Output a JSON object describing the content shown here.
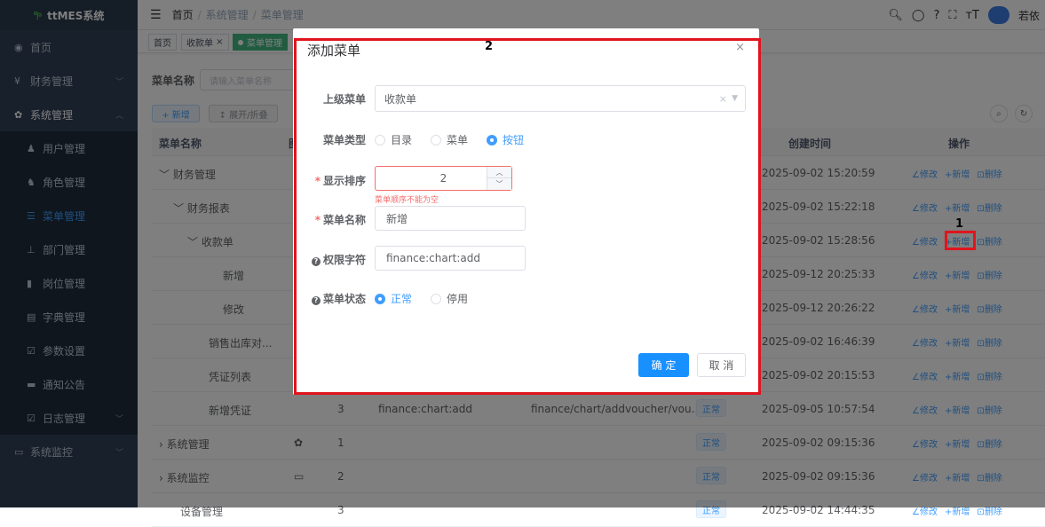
{
  "app": {
    "name": "ttMES系统"
  },
  "sidebar": {
    "items": [
      {
        "icon": "dashboard-icon",
        "label": "首页"
      },
      {
        "icon": "yen-icon",
        "label": "财务管理",
        "arrow": "﹀"
      },
      {
        "icon": "gear-icon",
        "label": "系统管理",
        "arrow": "︿"
      },
      {
        "icon": "user-icon",
        "label": "用户管理"
      },
      {
        "icon": "users-icon",
        "label": "角色管理"
      },
      {
        "icon": "menu-list-icon",
        "label": "菜单管理"
      },
      {
        "icon": "org-tree-icon",
        "label": "部门管理"
      },
      {
        "icon": "post-icon",
        "label": "岗位管理"
      },
      {
        "icon": "dict-icon",
        "label": "字典管理"
      },
      {
        "icon": "edit-icon",
        "label": "参数设置"
      },
      {
        "icon": "message-icon",
        "label": "通知公告"
      },
      {
        "icon": "log-icon",
        "label": "日志管理",
        "arrow": "﹀"
      },
      {
        "icon": "monitor-icon",
        "label": "系统监控",
        "arrow": "﹀"
      }
    ]
  },
  "header": {
    "breadcrumb": [
      "首页",
      "系统管理",
      "菜单管理"
    ],
    "user": "若依"
  },
  "tags": [
    "首页",
    "收款单",
    "菜单管理"
  ],
  "search": {
    "label": "菜单名称",
    "placeholder": "请输入菜单名称"
  },
  "toolbar": {
    "add": "+ 新增",
    "expand": "↕ 展开/折叠"
  },
  "table": {
    "headers": {
      "name": "菜单名称",
      "icon": "图",
      "created": "创建时间",
      "ops": "操作"
    },
    "ops": {
      "edit": "∠修改",
      "add": "+新增",
      "del": "⊡删除"
    },
    "rows": [
      {
        "name": "﹀ 财务管理",
        "created": "2025-09-02 15:20:59"
      },
      {
        "name": "﹀ 财务报表",
        "created": "2025-09-02 15:22:18"
      },
      {
        "name": "﹀ 收款单",
        "created": "2025-09-02 15:28:56"
      },
      {
        "name": "新增",
        "created": "2025-09-12 20:25:33"
      },
      {
        "name": "修改",
        "created": "2025-09-12 20:26:22"
      },
      {
        "name": "销售出库对...",
        "created": "2025-09-02 16:46:39"
      },
      {
        "name": "凭证列表",
        "created": "2025-09-02 20:15:53"
      },
      {
        "name": "新增凭证",
        "order": "3",
        "perm": "finance:chart:add",
        "path": "finance/chart/addvoucher/vou...",
        "status": "正常",
        "created": "2025-09-05 10:57:54"
      },
      {
        "name": "›  系统管理",
        "order": "1",
        "status": "正常",
        "created": "2025-09-02 09:15:36"
      },
      {
        "name": "›  系统监控",
        "order": "2",
        "status": "正常",
        "created": "2025-09-02 09:15:36"
      },
      {
        "name": "设备管理",
        "order": "3",
        "status": "正常",
        "created": "2025-09-02 14:44:35"
      }
    ]
  },
  "dialog": {
    "title": "添加菜单",
    "close": "×",
    "parent": {
      "label": "上级菜单",
      "value": "收款单"
    },
    "type": {
      "label": "菜单类型",
      "options": [
        "目录",
        "菜单",
        "按钮"
      ],
      "selected": "按钮"
    },
    "order": {
      "label": "显示排序",
      "value": "2",
      "error": "菜单顺序不能为空"
    },
    "name": {
      "label": "菜单名称",
      "value": "新增"
    },
    "perm": {
      "label": "权限字符",
      "value": "finance:chart:add"
    },
    "status": {
      "label": "菜单状态",
      "options": [
        "正常",
        "停用"
      ],
      "selected": "正常"
    },
    "ok": "确 定",
    "cancel": "取 消"
  },
  "annotations": {
    "a1": "1",
    "a2": "2"
  },
  "colors": {
    "primary": "#409eff",
    "danger": "#f56c6c",
    "sidebar": "#304156",
    "highlight": "#e0141e"
  }
}
